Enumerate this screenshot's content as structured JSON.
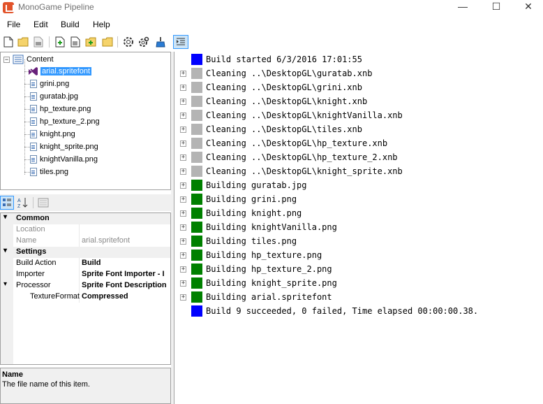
{
  "window": {
    "title": "MonoGame Pipeline",
    "minimize": "—",
    "maximize": "☐",
    "close": "✕"
  },
  "menu": [
    "File",
    "Edit",
    "Build",
    "Help"
  ],
  "toolbar": {
    "icons": [
      "new-file-icon",
      "open-folder-icon",
      "close-file-icon",
      "add-new-item-icon",
      "add-existing-item-icon",
      "new-folder-icon",
      "add-existing-folder-icon",
      "build-icon",
      "rebuild-icon",
      "clean-icon",
      "filter-output-icon"
    ]
  },
  "tree": {
    "root": "Content",
    "items": [
      {
        "label": "arial.spritefont",
        "selected": true,
        "icon": "visual-studio-icon"
      },
      {
        "label": "grini.png"
      },
      {
        "label": "guratab.jpg"
      },
      {
        "label": "hp_texture.png"
      },
      {
        "label": "hp_texture_2.png"
      },
      {
        "label": "knight.png"
      },
      {
        "label": "knight_sprite.png"
      },
      {
        "label": "knightVanilla.png"
      },
      {
        "label": "tiles.png"
      }
    ]
  },
  "properties": {
    "categories": [
      {
        "name": "Common",
        "rows": [
          {
            "label": "Location",
            "value": "",
            "disabled": true
          },
          {
            "label": "Name",
            "value": "arial.spritefont",
            "disabled": true
          }
        ]
      },
      {
        "name": "Settings",
        "rows": [
          {
            "label": "Build Action",
            "value": "Build"
          },
          {
            "label": "Importer",
            "value": "Sprite Font Importer - I"
          },
          {
            "label": "Processor",
            "value": "Sprite Font Description"
          },
          {
            "label": "TextureFormat",
            "value": "Compressed",
            "indent": true
          }
        ]
      }
    ]
  },
  "description": {
    "title": "Name",
    "text": "The file name of this item."
  },
  "output": {
    "colors": {
      "blue": "#0000ff",
      "gray": "#b4b4b4",
      "green": "#008000"
    },
    "rows": [
      {
        "status": "blue",
        "text": "Build started 6/3/2016 17:01:55",
        "expander": false
      },
      {
        "status": "gray",
        "text": "Cleaning ..\\DesktopGL\\guratab.xnb",
        "expander": true
      },
      {
        "status": "gray",
        "text": "Cleaning ..\\DesktopGL\\grini.xnb",
        "expander": true
      },
      {
        "status": "gray",
        "text": "Cleaning ..\\DesktopGL\\knight.xnb",
        "expander": true
      },
      {
        "status": "gray",
        "text": "Cleaning ..\\DesktopGL\\knightVanilla.xnb",
        "expander": true
      },
      {
        "status": "gray",
        "text": "Cleaning ..\\DesktopGL\\tiles.xnb",
        "expander": true
      },
      {
        "status": "gray",
        "text": "Cleaning ..\\DesktopGL\\hp_texture.xnb",
        "expander": true
      },
      {
        "status": "gray",
        "text": "Cleaning ..\\DesktopGL\\hp_texture_2.xnb",
        "expander": true
      },
      {
        "status": "gray",
        "text": "Cleaning ..\\DesktopGL\\knight_sprite.xnb",
        "expander": true
      },
      {
        "status": "green",
        "text": "Building guratab.jpg",
        "expander": true
      },
      {
        "status": "green",
        "text": "Building grini.png",
        "expander": true
      },
      {
        "status": "green",
        "text": "Building knight.png",
        "expander": true
      },
      {
        "status": "green",
        "text": "Building knightVanilla.png",
        "expander": true
      },
      {
        "status": "green",
        "text": "Building tiles.png",
        "expander": true
      },
      {
        "status": "green",
        "text": "Building hp_texture.png",
        "expander": true
      },
      {
        "status": "green",
        "text": "Building hp_texture_2.png",
        "expander": true
      },
      {
        "status": "green",
        "text": "Building knight_sprite.png",
        "expander": true
      },
      {
        "status": "green",
        "text": "Building arial.spritefont",
        "expander": true
      },
      {
        "status": "blue",
        "text": "Build 9 succeeded, 0 failed, Time elapsed 00:00:00.38.",
        "expander": false
      }
    ]
  }
}
